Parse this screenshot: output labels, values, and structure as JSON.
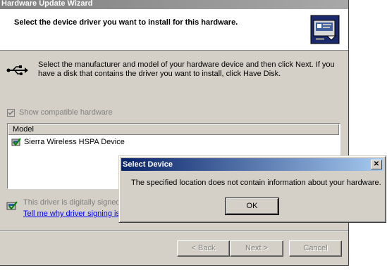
{
  "wizard": {
    "title": "Hardware Update Wizard",
    "header_title": "Select the device driver you want to install for this hardware.",
    "header_icon": "hardware-icon",
    "instructions": "Select the manufacturer and model of your hardware device and then click Next. If you have a disk that contains the driver you want to install, click Have Disk.",
    "instructions_icon": "usb-icon",
    "show_compatible_label": "Show compatible hardware",
    "show_compatible_checked": true,
    "list": {
      "column_header": "Model",
      "items": [
        {
          "label": "Sierra Wireless HSPA Device",
          "icon": "signed-driver-icon"
        }
      ]
    },
    "signed_text": "This driver is digitally signed.",
    "signing_link": "Tell me why driver signing is",
    "buttons": {
      "back": "< Back",
      "next": "Next >",
      "cancel": "Cancel"
    }
  },
  "dialog": {
    "title": "Select Device",
    "close": "✕",
    "message": "The specified location does not contain information about your hardware.",
    "ok": "OK"
  },
  "colors": {
    "dialog_face": "#d4d0c8",
    "title_active_start": "#0a246a",
    "title_active_end": "#a6caf0",
    "link": "#0000ff",
    "disabled_text": "#808080"
  }
}
